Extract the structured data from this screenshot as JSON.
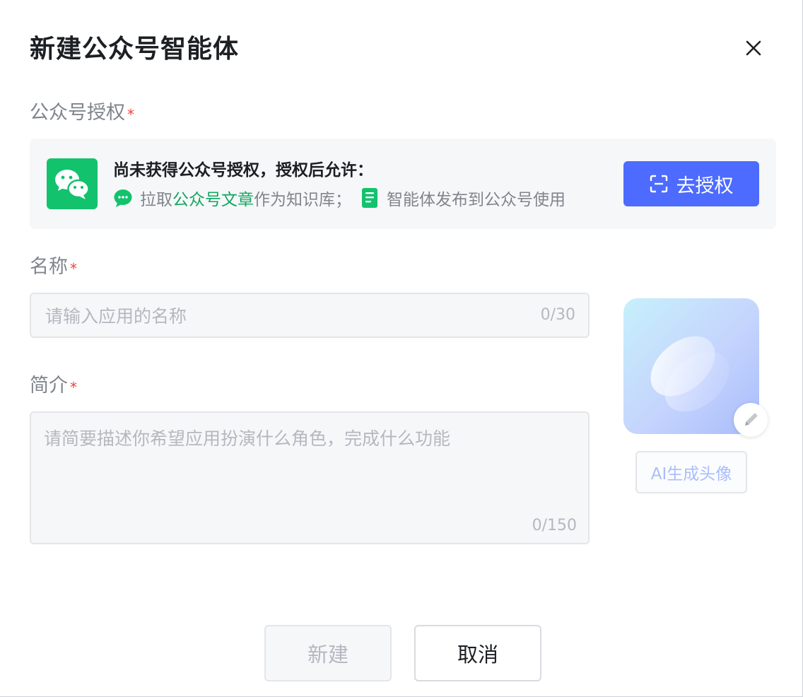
{
  "dialog": {
    "title": "新建公众号智能体"
  },
  "authorization": {
    "label": "公众号授权",
    "required_mark": "*",
    "notice_title": "尚未获得公众号授权，授权后允许：",
    "feature_1_prefix": "拉取",
    "feature_1_link": "公众号文章",
    "feature_1_suffix": "作为知识库；",
    "feature_2": "智能体发布到公众号使用",
    "button_label": "去授权"
  },
  "name_field": {
    "label": "名称",
    "required_mark": "*",
    "placeholder": "请输入应用的名称",
    "value": "",
    "counter": "0/30"
  },
  "intro_field": {
    "label": "简介",
    "required_mark": "*",
    "placeholder": "请简要描述你希望应用扮演什么角色，完成什么功能",
    "value": "",
    "counter": "0/150"
  },
  "avatar": {
    "ai_button_label": "AI生成头像"
  },
  "footer": {
    "create_label": "新建",
    "cancel_label": "取消"
  },
  "colors": {
    "primary": "#4d6bfe",
    "wechat_green": "#12c26d",
    "link_green": "#12a660",
    "required_red": "#f0413a"
  },
  "icons": {
    "close": "close-icon",
    "wechat": "wechat-logo-icon",
    "chat": "chat-bubble-icon",
    "document": "document-icon",
    "scan": "scan-icon",
    "edit": "pencil-icon"
  }
}
